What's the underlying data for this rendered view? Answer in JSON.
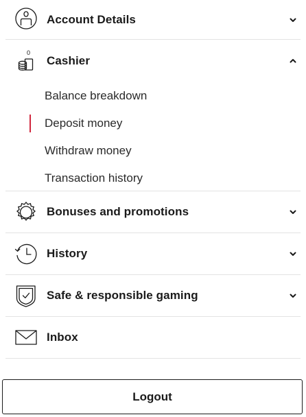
{
  "menu": {
    "account": {
      "label": "Account Details",
      "icon": "account-icon",
      "expanded": false
    },
    "cashier": {
      "label": "Cashier",
      "icon": "cashier-coins-icon",
      "expanded": true,
      "items": [
        {
          "label": "Balance breakdown",
          "active": false
        },
        {
          "label": "Deposit money",
          "active": true
        },
        {
          "label": "Withdraw money",
          "active": false
        },
        {
          "label": "Transaction history",
          "active": false
        }
      ]
    },
    "bonuses": {
      "label": "Bonuses and promotions",
      "icon": "gear-badge-icon",
      "expanded": false
    },
    "history": {
      "label": "History",
      "icon": "history-clock-icon",
      "expanded": false
    },
    "safe": {
      "label": "Safe & responsible gaming",
      "icon": "shield-check-icon",
      "expanded": false
    },
    "inbox": {
      "label": "Inbox",
      "icon": "envelope-icon"
    }
  },
  "logout_label": "Logout",
  "colors": {
    "text": "#1a1a1a",
    "divider": "#e3e3e3",
    "active_indicator": "#d0263d"
  }
}
